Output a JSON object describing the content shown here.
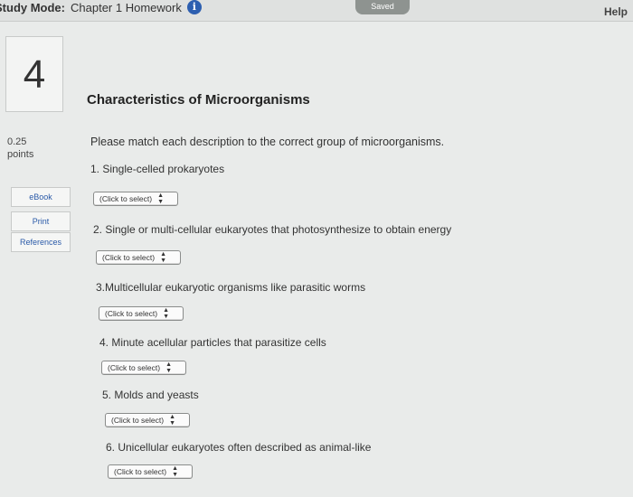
{
  "header": {
    "study_mode_label": "Study Mode:",
    "title": "Chapter 1 Homework",
    "info_icon": "i",
    "saved": "Saved",
    "help": "Help"
  },
  "question": {
    "number": "4",
    "points_value": "0.25",
    "points_label": "points",
    "heading": "Characteristics of Microorganisms",
    "instructions": "Please match each description to the correct group of microorganisms."
  },
  "sidebar": {
    "ebook": "eBook",
    "print": "Print",
    "references": "References"
  },
  "items": [
    {
      "text": "1. Single-celled prokaryotes",
      "select": "(Click to select)"
    },
    {
      "text": "2. Single or multi-cellular eukaryotes that photosynthesize to obtain energy",
      "select": "(Click to select)"
    },
    {
      "text": "3.Multicellular eukaryotic organisms like parasitic worms",
      "select": "(Click to select)"
    },
    {
      "text": "4. Minute acellular particles that parasitize cells",
      "select": "(Click to select)"
    },
    {
      "text": "5. Molds and yeasts",
      "select": "(Click to select)"
    },
    {
      "text": "6. Unicellular eukaryotes often described as animal-like",
      "select": "(Click to select)"
    }
  ],
  "icons": {
    "select_arrows": "updown-arrows-icon"
  }
}
